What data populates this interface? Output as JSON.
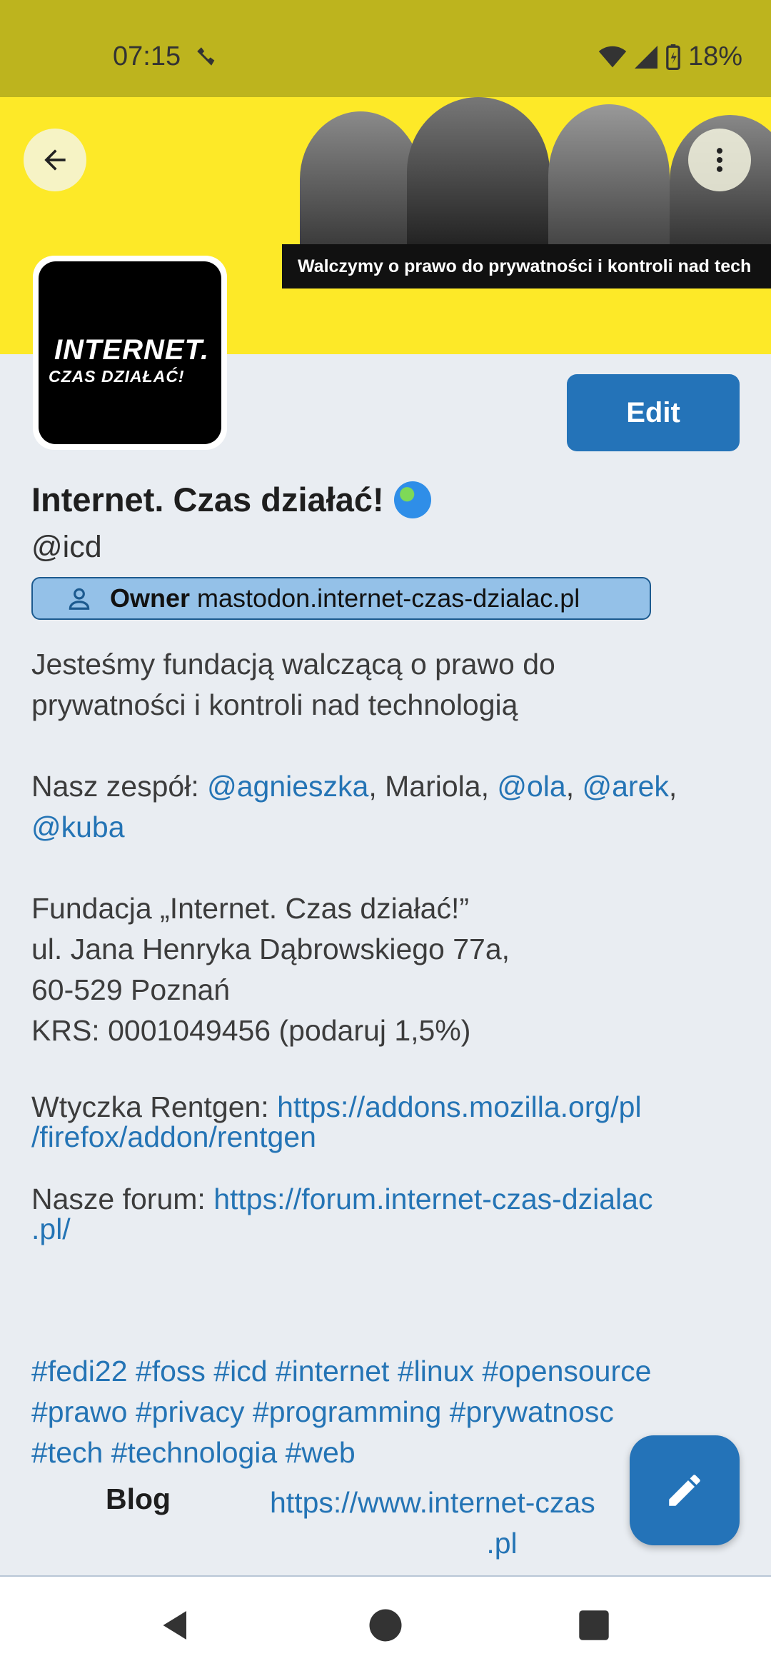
{
  "status_bar": {
    "time": "07:15",
    "battery": "18%"
  },
  "banner": {
    "caption": "Walczymy o prawo do prywatności i kontroli nad tech"
  },
  "avatar": {
    "line1": "INTERNET.",
    "line2": "CZAS DZIAŁAĆ!"
  },
  "profile": {
    "edit_label": "Edit",
    "display_name": "Internet. Czas działać!",
    "handle": "@icd",
    "role_label": "Owner",
    "role_domain": "mastodon.internet-czas-dzialac.pl"
  },
  "bio": {
    "p1_line1": "Jesteśmy fundacją walczącą o prawo do",
    "p1_line2": "prywatności i kontroli nad technologią",
    "team_prefix": "Nasz zespół: ",
    "team_m1": "@agnieszka",
    "team_sep1": ", Mariola, ",
    "team_m2": "@ola",
    "team_sep2": ", ",
    "team_m3": "@arek",
    "team_sep3": ",",
    "team_m4": "@kuba",
    "addr1": "Fundacja „Internet. Czas działać!”",
    "addr2": "ul. Jana Henryka Dąbrowskiego 77a,",
    "addr3": "60-529 Poznań",
    "addr4": "KRS: 0001049456 (podaruj 1,5%)",
    "plugin_prefix": "Wtyczka Rentgen: ",
    "plugin_link_1": "https://addons.mozilla.org/pl",
    "plugin_link_2": "/firefox/addon/rentgen",
    "forum_prefix": "Nasze forum: ",
    "forum_link_1": "https://forum.internet-czas-dzialac",
    "forum_link_2": ".pl/"
  },
  "hashtags": {
    "line1": "#fedi22 #foss #icd #internet #linux #opensource",
    "line2": "#prawo #privacy #programming #prywatnosc",
    "line3": "#tech #technologia #web"
  },
  "fields": [
    {
      "label": "Blog",
      "value_line1": "https://www.internet-czas",
      "value_line2": ".pl"
    }
  ],
  "icons": [
    "back-arrow-icon",
    "more-vertical-icon",
    "person-icon",
    "pencil-icon",
    "nav-back-icon",
    "nav-home-icon",
    "nav-recents-icon"
  ]
}
